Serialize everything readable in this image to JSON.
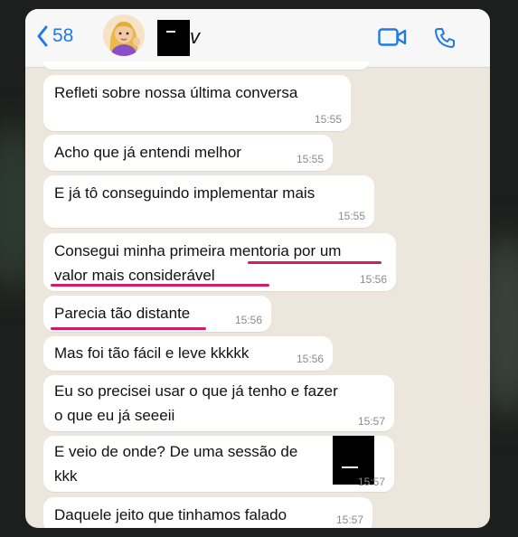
{
  "header": {
    "back_count": "58",
    "name_tail": "v"
  },
  "messages": [
    {
      "lines": "Refleti sobre nossa última conversa",
      "time": "15:55"
    },
    {
      "lines": "Acho que já entendi melhor",
      "time": "15:55"
    },
    {
      "lines": "E já tô conseguindo implementar mais",
      "time": "15:55"
    },
    {
      "lines": "Consegui minha primeira mentoria por um\nvalor mais considerável",
      "time": "15:56"
    },
    {
      "lines": "Parecia tão distante",
      "time": "15:56"
    },
    {
      "lines": "Mas foi tão fácil e leve kkkkk",
      "time": "15:56"
    },
    {
      "lines": "Eu so precisei usar o que já tenho e fazer\no que eu já seeeii",
      "time": "15:57"
    },
    {
      "lines": "E veio de onde? De uma sessão de\nkkk",
      "time": "15:57"
    },
    {
      "lines": "Daquele jeito que tinhamos falado",
      "time": "15:57"
    }
  ],
  "colors": {
    "accent": "#1f7ae8",
    "highlight_underline": "#d41b66",
    "chat_background": "#ece6dc",
    "bubble": "#ffffff"
  }
}
